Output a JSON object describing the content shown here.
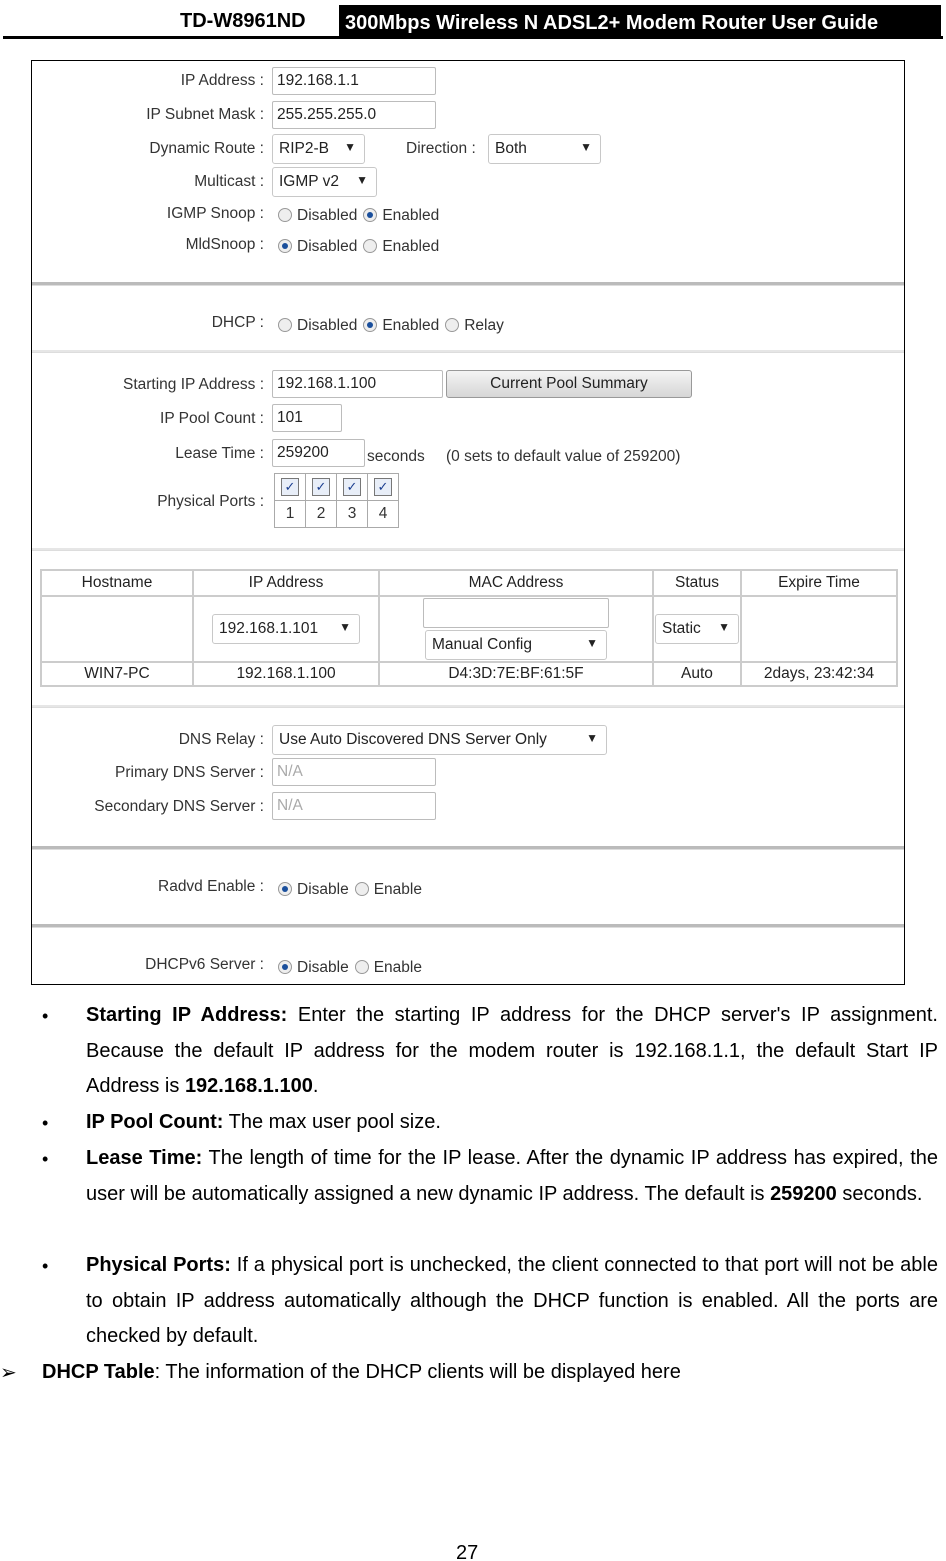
{
  "header": {
    "model": "TD-W8961ND",
    "title": "300Mbps Wireless N ADSL2+ Modem Router User Guide"
  },
  "form": {
    "ip_address": {
      "label": "IP Address :",
      "value": "192.168.1.1"
    },
    "subnet": {
      "label": "IP Subnet Mask :",
      "value": "255.255.255.0"
    },
    "dynamic_route": {
      "label": "Dynamic Route :",
      "value": "RIP2-B"
    },
    "direction": {
      "label": "Direction :",
      "value": "Both"
    },
    "multicast": {
      "label": "Multicast :",
      "value": "IGMP v2"
    },
    "igmp_snoop": {
      "label": "IGMP Snoop :",
      "options": [
        "Disabled",
        "Enabled"
      ],
      "selected": "Enabled"
    },
    "mld_snoop": {
      "label": "MldSnoop :",
      "options": [
        "Disabled",
        "Enabled"
      ],
      "selected": "Disabled"
    },
    "dhcp": {
      "label": "DHCP :",
      "options": [
        "Disabled",
        "Enabled",
        "Relay"
      ],
      "selected": "Enabled"
    },
    "starting_ip": {
      "label": "Starting IP Address :",
      "value": "192.168.1.100"
    },
    "pool_summary_button": "Current Pool Summary",
    "pool_count": {
      "label": "IP Pool Count :",
      "value": "101"
    },
    "lease_time": {
      "label": "Lease Time :",
      "value": "259200",
      "unit": "seconds",
      "hint": "(0 sets to default value of 259200)"
    },
    "physical_ports": {
      "label": "Physical Ports :",
      "ports": [
        "1",
        "2",
        "3",
        "4"
      ],
      "checked": [
        true,
        true,
        true,
        true
      ]
    },
    "dhcp_table": {
      "headers": [
        "Hostname",
        "IP Address",
        "MAC Address",
        "Status",
        "Expire Time"
      ],
      "edit_row": {
        "ip": "192.168.1.101",
        "mac": "",
        "mac_mode": "Manual Config",
        "status": "Static"
      },
      "rows": [
        [
          "WIN7-PC",
          "192.168.1.100",
          "D4:3D:7E:BF:61:5F",
          "Auto",
          "2days, 23:42:34"
        ]
      ]
    },
    "dns_relay": {
      "label": "DNS Relay :",
      "value": "Use Auto Discovered DNS Server Only"
    },
    "primary_dns": {
      "label": "Primary DNS Server :",
      "value": "N/A"
    },
    "secondary_dns": {
      "label": "Secondary DNS Server :",
      "value": "N/A"
    },
    "radvd": {
      "label": "Radvd Enable :",
      "options": [
        "Disable",
        "Enable"
      ],
      "selected": "Disable"
    },
    "dhcpv6": {
      "label": "DHCPv6 Server :",
      "options": [
        "Disable",
        "Enable"
      ],
      "selected": "Disable"
    }
  },
  "bullets": [
    {
      "term": "Starting IP Address:",
      "text": " Enter the starting IP address for the DHCP server's IP assignment. Because the default IP address for the modem router is 192.168.1.1, the default Start IP Address is ",
      "bold_value": "192.168.1.100",
      "tail": "."
    },
    {
      "term": "IP Pool Count:",
      "text": " The max user pool size.",
      "bold_value": "",
      "tail": ""
    },
    {
      "term": "Lease Time:",
      "text": " The length of time for the IP lease. After the dynamic IP address has expired, the user will be automatically assigned a new dynamic IP address. The default is ",
      "bold_value": "259200",
      "tail": " seconds."
    },
    {
      "term": "Physical Ports:",
      "text": " If a physical port is unchecked, the client connected to that port will not be able to obtain IP address automatically although the DHCP function is enabled. All the ports are checked by default.",
      "bold_value": "",
      "tail": ""
    }
  ],
  "dhcp_table_item": {
    "term": "DHCP Table",
    "text": ": The information of the DHCP clients will be displayed here"
  },
  "page_number": "27"
}
